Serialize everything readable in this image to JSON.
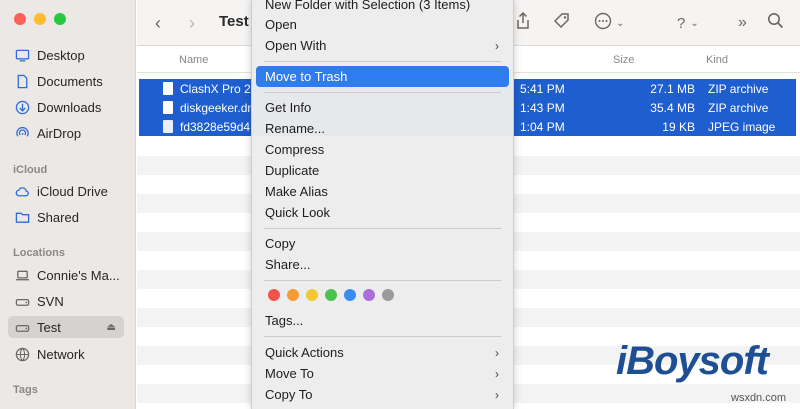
{
  "window": {
    "title": "Test"
  },
  "colors": {
    "accent": "#2f7bf0",
    "selection": "#1f5ecf",
    "traffic_red": "#fe5f57",
    "traffic_yellow": "#febc2e",
    "traffic_green": "#28c840"
  },
  "sidebar": {
    "favorites": [
      {
        "label": "Desktop",
        "icon": "desktop-icon"
      },
      {
        "label": "Documents",
        "icon": "document-icon"
      },
      {
        "label": "Downloads",
        "icon": "download-icon"
      },
      {
        "label": "AirDrop",
        "icon": "airdrop-icon"
      }
    ],
    "icloud_heading": "iCloud",
    "icloud": [
      {
        "label": "iCloud Drive",
        "icon": "cloud-icon"
      },
      {
        "label": "Shared",
        "icon": "shared-folder-icon"
      }
    ],
    "locations_heading": "Locations",
    "locations": [
      {
        "label": "Connie's Ma...",
        "icon": "laptop-icon"
      },
      {
        "label": "SVN",
        "icon": "drive-icon"
      },
      {
        "label": "Test",
        "icon": "drive-icon"
      },
      {
        "label": "Network",
        "icon": "network-icon"
      }
    ],
    "tags_heading": "Tags"
  },
  "columns": {
    "name": "Name",
    "size": "Size",
    "kind": "Kind"
  },
  "files": [
    {
      "name": "ClashX Pro 2.",
      "date": "5:41 PM",
      "size": "27.1 MB",
      "kind": "ZIP archive"
    },
    {
      "name": "diskgeeker.dn",
      "date": "1:43 PM",
      "size": "35.4 MB",
      "kind": "ZIP archive"
    },
    {
      "name": "fd3828e59d4",
      "date": "1:04 PM",
      "size": "19 KB",
      "kind": "JPEG image"
    }
  ],
  "menu": {
    "new_folder": "New Folder with Selection (3 Items)",
    "open": "Open",
    "open_with": "Open With",
    "move_to_trash": "Move to Trash",
    "get_info": "Get Info",
    "rename": "Rename...",
    "compress": "Compress",
    "duplicate": "Duplicate",
    "make_alias": "Make Alias",
    "quick_look": "Quick Look",
    "copy": "Copy",
    "share": "Share...",
    "tag_colors": [
      "#f0534a",
      "#f69a33",
      "#f5c833",
      "#4cc34f",
      "#3a8bf2",
      "#a96ed8",
      "#9b9b9b"
    ],
    "tags": "Tags...",
    "quick_actions": "Quick Actions",
    "move_to": "Move To",
    "copy_to": "Copy To"
  },
  "watermark": {
    "logo": "iBoysoft",
    "site": "wsxdn.com"
  }
}
